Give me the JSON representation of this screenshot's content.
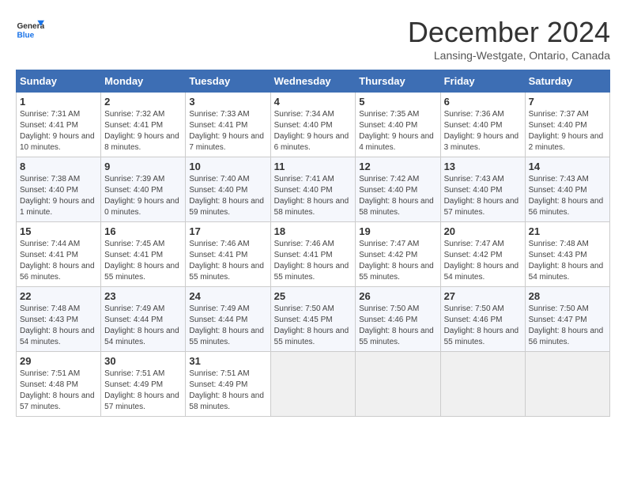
{
  "logo": {
    "line1": "General",
    "line2": "Blue"
  },
  "title": "December 2024",
  "subtitle": "Lansing-Westgate, Ontario, Canada",
  "days_of_week": [
    "Sunday",
    "Monday",
    "Tuesday",
    "Wednesday",
    "Thursday",
    "Friday",
    "Saturday"
  ],
  "weeks": [
    [
      {
        "day": "1",
        "sunrise": "7:31 AM",
        "sunset": "4:41 PM",
        "daylight": "9 hours and 10 minutes."
      },
      {
        "day": "2",
        "sunrise": "7:32 AM",
        "sunset": "4:41 PM",
        "daylight": "9 hours and 8 minutes."
      },
      {
        "day": "3",
        "sunrise": "7:33 AM",
        "sunset": "4:41 PM",
        "daylight": "9 hours and 7 minutes."
      },
      {
        "day": "4",
        "sunrise": "7:34 AM",
        "sunset": "4:40 PM",
        "daylight": "9 hours and 6 minutes."
      },
      {
        "day": "5",
        "sunrise": "7:35 AM",
        "sunset": "4:40 PM",
        "daylight": "9 hours and 4 minutes."
      },
      {
        "day": "6",
        "sunrise": "7:36 AM",
        "sunset": "4:40 PM",
        "daylight": "9 hours and 3 minutes."
      },
      {
        "day": "7",
        "sunrise": "7:37 AM",
        "sunset": "4:40 PM",
        "daylight": "9 hours and 2 minutes."
      }
    ],
    [
      {
        "day": "8",
        "sunrise": "7:38 AM",
        "sunset": "4:40 PM",
        "daylight": "9 hours and 1 minute."
      },
      {
        "day": "9",
        "sunrise": "7:39 AM",
        "sunset": "4:40 PM",
        "daylight": "9 hours and 0 minutes."
      },
      {
        "day": "10",
        "sunrise": "7:40 AM",
        "sunset": "4:40 PM",
        "daylight": "8 hours and 59 minutes."
      },
      {
        "day": "11",
        "sunrise": "7:41 AM",
        "sunset": "4:40 PM",
        "daylight": "8 hours and 58 minutes."
      },
      {
        "day": "12",
        "sunrise": "7:42 AM",
        "sunset": "4:40 PM",
        "daylight": "8 hours and 58 minutes."
      },
      {
        "day": "13",
        "sunrise": "7:43 AM",
        "sunset": "4:40 PM",
        "daylight": "8 hours and 57 minutes."
      },
      {
        "day": "14",
        "sunrise": "7:43 AM",
        "sunset": "4:40 PM",
        "daylight": "8 hours and 56 minutes."
      }
    ],
    [
      {
        "day": "15",
        "sunrise": "7:44 AM",
        "sunset": "4:41 PM",
        "daylight": "8 hours and 56 minutes."
      },
      {
        "day": "16",
        "sunrise": "7:45 AM",
        "sunset": "4:41 PM",
        "daylight": "8 hours and 55 minutes."
      },
      {
        "day": "17",
        "sunrise": "7:46 AM",
        "sunset": "4:41 PM",
        "daylight": "8 hours and 55 minutes."
      },
      {
        "day": "18",
        "sunrise": "7:46 AM",
        "sunset": "4:41 PM",
        "daylight": "8 hours and 55 minutes."
      },
      {
        "day": "19",
        "sunrise": "7:47 AM",
        "sunset": "4:42 PM",
        "daylight": "8 hours and 55 minutes."
      },
      {
        "day": "20",
        "sunrise": "7:47 AM",
        "sunset": "4:42 PM",
        "daylight": "8 hours and 54 minutes."
      },
      {
        "day": "21",
        "sunrise": "7:48 AM",
        "sunset": "4:43 PM",
        "daylight": "8 hours and 54 minutes."
      }
    ],
    [
      {
        "day": "22",
        "sunrise": "7:48 AM",
        "sunset": "4:43 PM",
        "daylight": "8 hours and 54 minutes."
      },
      {
        "day": "23",
        "sunrise": "7:49 AM",
        "sunset": "4:44 PM",
        "daylight": "8 hours and 54 minutes."
      },
      {
        "day": "24",
        "sunrise": "7:49 AM",
        "sunset": "4:44 PM",
        "daylight": "8 hours and 55 minutes."
      },
      {
        "day": "25",
        "sunrise": "7:50 AM",
        "sunset": "4:45 PM",
        "daylight": "8 hours and 55 minutes."
      },
      {
        "day": "26",
        "sunrise": "7:50 AM",
        "sunset": "4:46 PM",
        "daylight": "8 hours and 55 minutes."
      },
      {
        "day": "27",
        "sunrise": "7:50 AM",
        "sunset": "4:46 PM",
        "daylight": "8 hours and 55 minutes."
      },
      {
        "day": "28",
        "sunrise": "7:50 AM",
        "sunset": "4:47 PM",
        "daylight": "8 hours and 56 minutes."
      }
    ],
    [
      {
        "day": "29",
        "sunrise": "7:51 AM",
        "sunset": "4:48 PM",
        "daylight": "8 hours and 57 minutes."
      },
      {
        "day": "30",
        "sunrise": "7:51 AM",
        "sunset": "4:49 PM",
        "daylight": "8 hours and 57 minutes."
      },
      {
        "day": "31",
        "sunrise": "7:51 AM",
        "sunset": "4:49 PM",
        "daylight": "8 hours and 58 minutes."
      },
      null,
      null,
      null,
      null
    ]
  ],
  "labels": {
    "sunrise": "Sunrise:",
    "sunset": "Sunset:",
    "daylight": "Daylight:"
  },
  "colors": {
    "header_bg": "#3d6eb4",
    "header_text": "#ffffff",
    "accent": "#1a73e8"
  }
}
